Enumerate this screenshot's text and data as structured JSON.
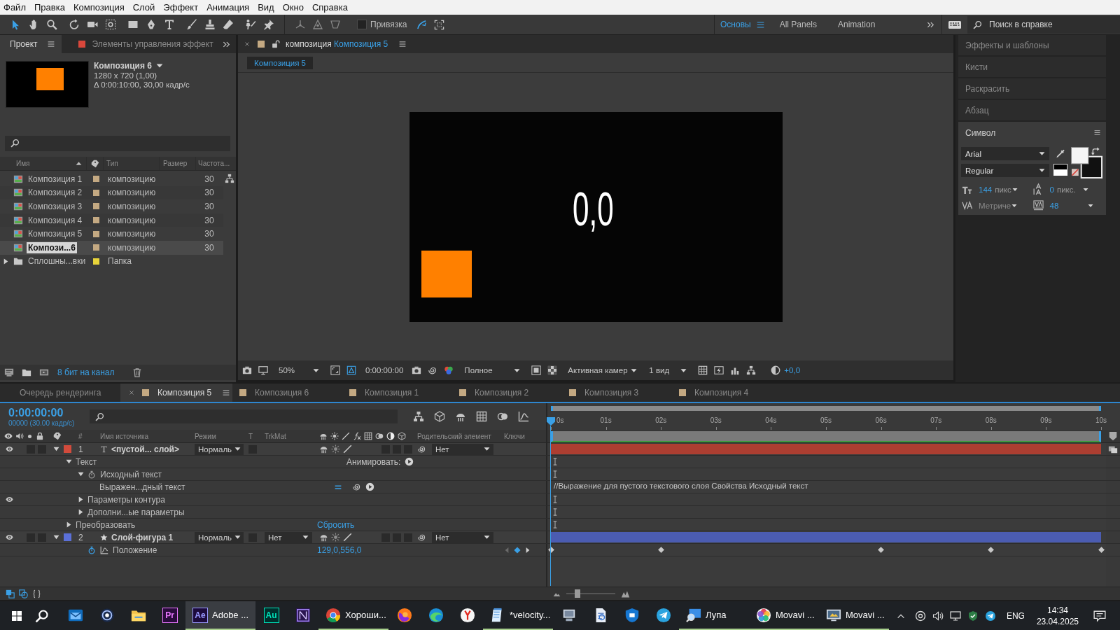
{
  "menu_bar": {
    "items": [
      "Файл",
      "Правка",
      "Композиция",
      "Слой",
      "Эффект",
      "Анимация",
      "Вид",
      "Окно",
      "Справка"
    ]
  },
  "toolbar": {
    "tools": [
      {
        "selected": true
      },
      {
        "selected": false
      },
      {
        "selected": false
      },
      {
        "selected": false
      },
      {
        "selected": false
      },
      {
        "selected": false
      },
      {
        "selected": false
      },
      {
        "selected": false
      },
      {
        "selected": false
      },
      {
        "selected": false
      },
      {
        "selected": false
      },
      {
        "selected": false
      },
      {
        "selected": false
      },
      {
        "selected": false
      }
    ],
    "snapping": {
      "label": "Привязка",
      "checked": false
    },
    "workspaces": [
      {
        "label": "Основы",
        "selected": true
      },
      {
        "label": "All Panels",
        "selected": false
      },
      {
        "label": "Animation",
        "selected": false
      }
    ],
    "help_search": {
      "placeholder": "Поиск в справке"
    }
  },
  "project_panel": {
    "tabs": [
      {
        "label": "Проект",
        "selected": true
      },
      {
        "label": "Элементы управления эффект",
        "selected": false,
        "color": "#d9473b"
      }
    ],
    "preview": {
      "title": "Композиция 6",
      "size": "1280 x 720 (1,00)",
      "duration": "Δ 0:00:10:00, 30,00 кадр/с"
    },
    "columns": [
      "Имя",
      "Тип",
      "Размер",
      "Частота..."
    ],
    "items": [
      {
        "kind": "composition",
        "name": "Композиция 1",
        "color": "#c4a982",
        "type": "композицию",
        "rate": "30",
        "selected": false
      },
      {
        "kind": "composition",
        "name": "Композиция 2",
        "color": "#c4a982",
        "type": "композицию",
        "rate": "30",
        "selected": false
      },
      {
        "kind": "composition",
        "name": "Композиция 3",
        "color": "#c4a982",
        "type": "композицию",
        "rate": "30",
        "selected": false
      },
      {
        "kind": "composition",
        "name": "Композиция 4",
        "color": "#c4a982",
        "type": "композицию",
        "rate": "30",
        "selected": false
      },
      {
        "kind": "composition",
        "name": "Композиция 5",
        "color": "#c4a982",
        "type": "композицию",
        "rate": "30",
        "selected": false
      },
      {
        "kind": "composition",
        "name": "Компози...6",
        "color": "#c4a982",
        "type": "композицию",
        "rate": "30",
        "selected": true
      },
      {
        "kind": "folder",
        "name": "Сплошны...вки",
        "color": "#e8d43a",
        "type": "Папка",
        "expanded": false,
        "selected": false
      }
    ],
    "bit_depth": "8 бит на канал"
  },
  "viewer": {
    "tab": {
      "label": "композиция",
      "name": "Композиция 5",
      "color": "#c4a982"
    },
    "breadcrumb": "Композиция 5",
    "canvas_text": "0,0",
    "controls": {
      "zoom": "50%",
      "timecode": "0:00:00:00",
      "resolution": "Полное",
      "camera": "Активная камер",
      "views": "1 вид",
      "exposure": "+0,0"
    }
  },
  "effects_panel": {
    "sections": [
      {
        "title": "Эффекты и шаблоны",
        "expanded": false
      },
      {
        "title": "Кисти",
        "expanded": false
      },
      {
        "title": "Раскрасить",
        "expanded": false
      },
      {
        "title": "Абзац",
        "expanded": false
      },
      {
        "title": "Символ",
        "expanded": true
      }
    ],
    "character": {
      "font": "Arial",
      "style": "Regular",
      "swatches": [
        {
          "kind": "fill",
          "color": "#f5f5f5"
        },
        {
          "kind": "stroke",
          "color": "#111111"
        }
      ],
      "size": "144",
      "size_unit": "пикс",
      "leading": "0",
      "leading_unit": "пикс.",
      "kerning": "Метриче",
      "tracking": "48"
    }
  },
  "timeline": {
    "tabs": [
      {
        "label": "Очередь рендеринга",
        "selected": false
      },
      {
        "label": "Композиция 5",
        "selected": true,
        "color": "#c4a982"
      },
      {
        "label": "Композиция 6",
        "selected": false,
        "color": "#c4a982"
      },
      {
        "label": "Композиция 1",
        "selected": false,
        "color": "#c4a982"
      },
      {
        "label": "Композиция 2",
        "selected": false,
        "color": "#c4a982"
      },
      {
        "label": "Композиция 3",
        "selected": false,
        "color": "#c4a982"
      },
      {
        "label": "Композиция 4",
        "selected": false,
        "color": "#c4a982"
      }
    ],
    "timecode": "0:00:00:00",
    "frame_info": "00000 (30.00 кадр/с)",
    "columns": {
      "number": "#",
      "source_name": "Имя источника",
      "mode": "Режим",
      "preserve": "T",
      "track_matte": "TrkMat",
      "parent": "Родительский элемент",
      "keys": "Ключи"
    },
    "ruler": [
      "0s",
      "01s",
      "02s",
      "03s",
      "04s",
      "05s",
      "06s",
      "07s",
      "08s",
      "09s",
      "10s"
    ],
    "layers": [
      {
        "kind": "text",
        "number": "1",
        "name": "<пустой... слой>",
        "color": "#d24b3c",
        "visible": true,
        "expanded": true,
        "mode": "Нормаль",
        "parent": "Нет",
        "children": [
          {
            "kind": "group",
            "name": "Текст",
            "expanded": true,
            "animate": "Анимировать:",
            "children": [
              {
                "kind": "property",
                "name": "Исходный текст",
                "expanded": true,
                "stopwatch": false,
                "children": [
                  {
                    "kind": "expression",
                    "name": "Выражен...дный текст",
                    "expression": "//Выражение для пустого текстового слоя Свойства Исходный текст"
                  }
                ]
              },
              {
                "kind": "group",
                "name": "Параметры контура",
                "expanded": false,
                "visible": true
              },
              {
                "kind": "group",
                "name": "Дополни...ые параметры",
                "expanded": false
              }
            ]
          },
          {
            "kind": "group",
            "name": "Преобразовать",
            "expanded": false,
            "reset": "Сбросить"
          }
        ]
      },
      {
        "kind": "shape",
        "number": "2",
        "name": "Слой-фигура 1",
        "color": "#5b70d8",
        "visible": true,
        "expanded": true,
        "mode": "Нормаль",
        "track_matte": "Нет",
        "parent": "Нет",
        "children": [
          {
            "kind": "property",
            "name": "Положение",
            "stopwatch": true,
            "value": "129,0,556,0",
            "keyframes": [
              {
                "level": 0
              },
              {
                "level": 0.2
              },
              {
                "level": 0.6
              },
              {
                "level": 0.8
              },
              {
                "level": 1
              }
            ]
          }
        ]
      }
    ]
  },
  "taskbar": {
    "apps": [
      {
        "selected": false,
        "running": false
      },
      {
        "selected": false,
        "running": false
      },
      {
        "selected": false,
        "running": false
      },
      {
        "badge": "Pr",
        "selected": false,
        "running": false
      },
      {
        "badge": "Ae",
        "label": "Adobe ...",
        "selected": true,
        "running": true
      },
      {
        "badge": "Au",
        "selected": false,
        "running": false
      },
      {
        "selected": false,
        "running": false
      },
      {
        "label": "Хороши...",
        "selected": false,
        "running": true
      },
      {
        "selected": false,
        "running": false
      },
      {
        "selected": false,
        "running": false
      },
      {
        "selected": false,
        "running": false
      },
      {
        "label": "*velocity...",
        "selected": false,
        "running": true
      },
      {
        "selected": false,
        "running": false
      },
      {
        "selected": false,
        "running": false
      },
      {
        "selected": false,
        "running": false
      },
      {
        "selected": false,
        "running": false
      },
      {
        "label": "Лупа",
        "selected": false,
        "running": true
      },
      {
        "label": "Movavi ...",
        "selected": false,
        "running": true
      },
      {
        "label": "Movavi ...",
        "selected": false,
        "running": true
      }
    ],
    "language": "ENG",
    "time": "14:34",
    "date": "23.04.2025"
  }
}
